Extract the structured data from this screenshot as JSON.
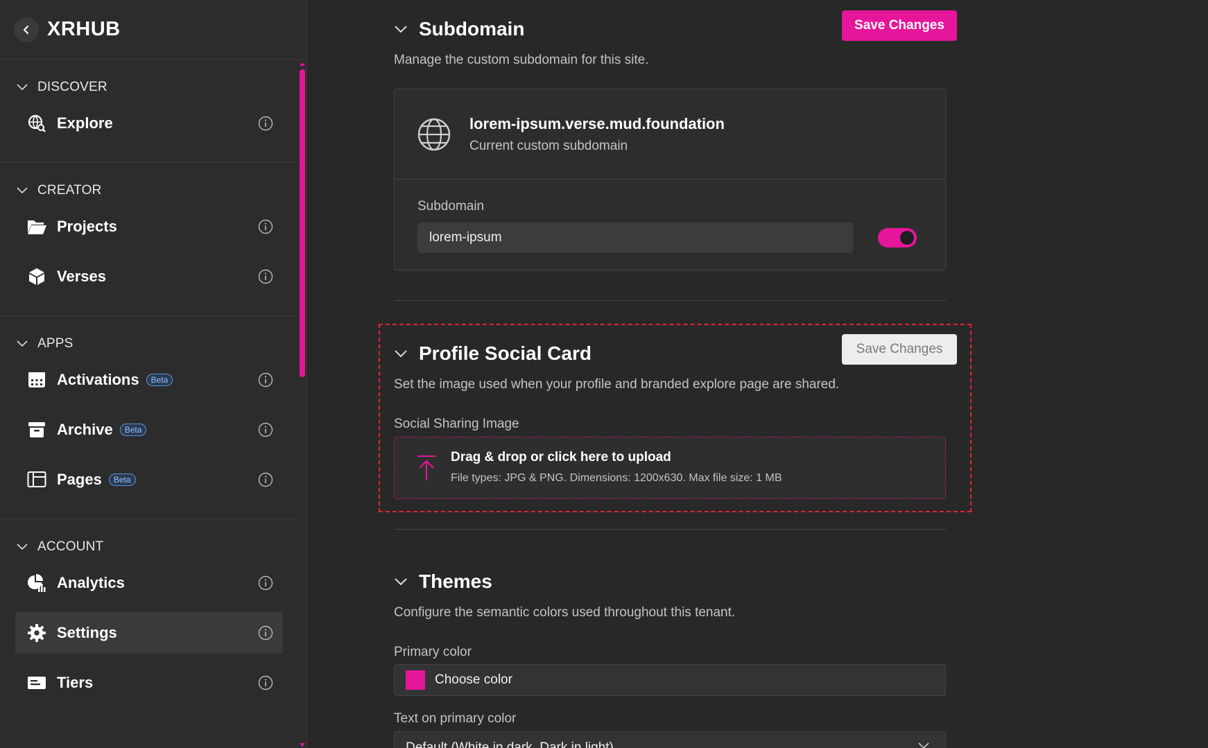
{
  "brand": {
    "title": "XRHUB"
  },
  "sidebar": {
    "sections": [
      {
        "label": "DISCOVER",
        "items": [
          {
            "label": "Explore",
            "icon": "globe-search-icon"
          }
        ]
      },
      {
        "label": "CREATOR",
        "items": [
          {
            "label": "Projects",
            "icon": "folder-open-icon"
          },
          {
            "label": "Verses",
            "icon": "cube-icon"
          }
        ]
      },
      {
        "label": "APPS",
        "items": [
          {
            "label": "Activations",
            "icon": "calendar-icon",
            "badge": "Beta"
          },
          {
            "label": "Archive",
            "icon": "archive-box-icon",
            "badge": "Beta"
          },
          {
            "label": "Pages",
            "icon": "layout-icon",
            "badge": "Beta"
          }
        ]
      },
      {
        "label": "ACCOUNT",
        "items": [
          {
            "label": "Analytics",
            "icon": "chart-pie-icon"
          },
          {
            "label": "Settings",
            "icon": "gear-icon",
            "active": true
          },
          {
            "label": "Tiers",
            "icon": "ticket-icon"
          }
        ]
      }
    ]
  },
  "subdomain": {
    "title": "Subdomain",
    "save_label": "Save Changes",
    "description": "Manage the custom subdomain for this site.",
    "current_domain": "lorem-ipsum.verse.mud.foundation",
    "current_label": "Current custom subdomain",
    "field_label": "Subdomain",
    "field_value": "lorem-ipsum",
    "toggle_on": true
  },
  "social_card": {
    "title": "Profile Social Card",
    "save_label": "Save Changes",
    "description": "Set the image used when your profile and branded explore page are shared.",
    "field_label": "Social Sharing Image",
    "upload_title": "Drag & drop or click here to upload",
    "upload_sub": "File types: JPG & PNG. Dimensions: 1200x630. Max file size: 1 MB"
  },
  "themes": {
    "title": "Themes",
    "description": "Configure the semantic colors used throughout this tenant.",
    "primary_label": "Primary color",
    "primary_value": "Choose color",
    "text_label": "Text on primary color",
    "text_value": "Default (White in dark, Dark in light)"
  },
  "colors": {
    "accent": "#e5169a",
    "background": "#282828",
    "sidebar": "#2c2c2c",
    "beta": "#8fc1ff",
    "highlight_border": "#e1262d"
  }
}
